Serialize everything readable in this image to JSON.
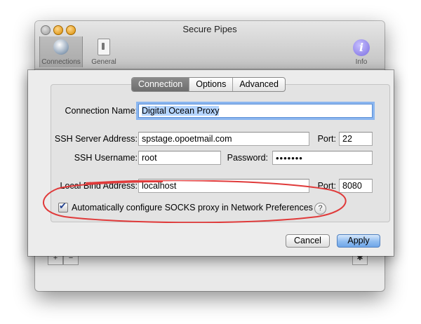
{
  "window": {
    "title": "Secure Pipes"
  },
  "toolbar": {
    "items": [
      {
        "label": "Connections",
        "icon": "globe-icon"
      },
      {
        "label": "General",
        "icon": "switch-icon"
      },
      {
        "label": "Info",
        "icon": "info-icon"
      }
    ]
  },
  "tabs": [
    {
      "label": "Connection",
      "selected": true
    },
    {
      "label": "Options",
      "selected": false
    },
    {
      "label": "Advanced",
      "selected": false
    }
  ],
  "form": {
    "connection_name": {
      "label": "Connection Name:",
      "value": "Digital Ocean Proxy"
    },
    "ssh_server": {
      "label": "SSH Server Address:",
      "value": "spstage.opoetmail.com"
    },
    "port": {
      "label": "Port:",
      "value": "22"
    },
    "ssh_username": {
      "label": "SSH Username:",
      "value": "root"
    },
    "password": {
      "label": "Password:",
      "value": "•••••••"
    },
    "local_bind": {
      "label": "Local Bind Address:",
      "value": "localhost"
    },
    "local_port": {
      "label": "Port:",
      "value": "8080"
    },
    "auto_socks": {
      "label": "Automatically configure SOCKS proxy in Network Preferences",
      "checked": true
    },
    "help": "?"
  },
  "buttons": {
    "cancel": "Cancel",
    "apply": "Apply"
  },
  "colors": {
    "highlight_ellipse": "#e03a3a",
    "focus_ring": "#8bb6ef",
    "default_button": "#8fbcf0"
  }
}
